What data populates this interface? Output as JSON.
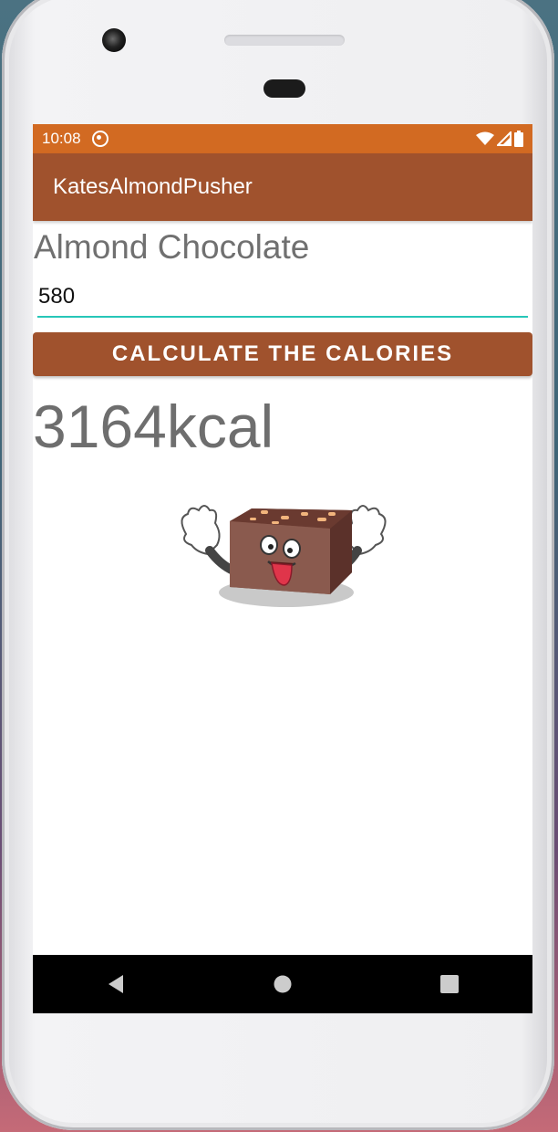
{
  "status_bar": {
    "time": "10:08",
    "icons": [
      "sync-icon",
      "wifi-icon",
      "signal-icon",
      "battery-icon"
    ]
  },
  "app_bar": {
    "title": "KatesAlmondPusher"
  },
  "main": {
    "product_label": "Almond Chocolate",
    "grams_input_value": "580",
    "calculate_button_label": "CALCULATE THE CALORIES",
    "result_text": "3164kcal",
    "mascot_image": "chocolate-mascot-illustration"
  },
  "nav_bar": {
    "icons": [
      "back-icon",
      "home-icon",
      "recents-icon"
    ]
  },
  "colors": {
    "status_bar": "#d26a22",
    "primary": "#a0522d",
    "accent": "#26c6b8"
  }
}
